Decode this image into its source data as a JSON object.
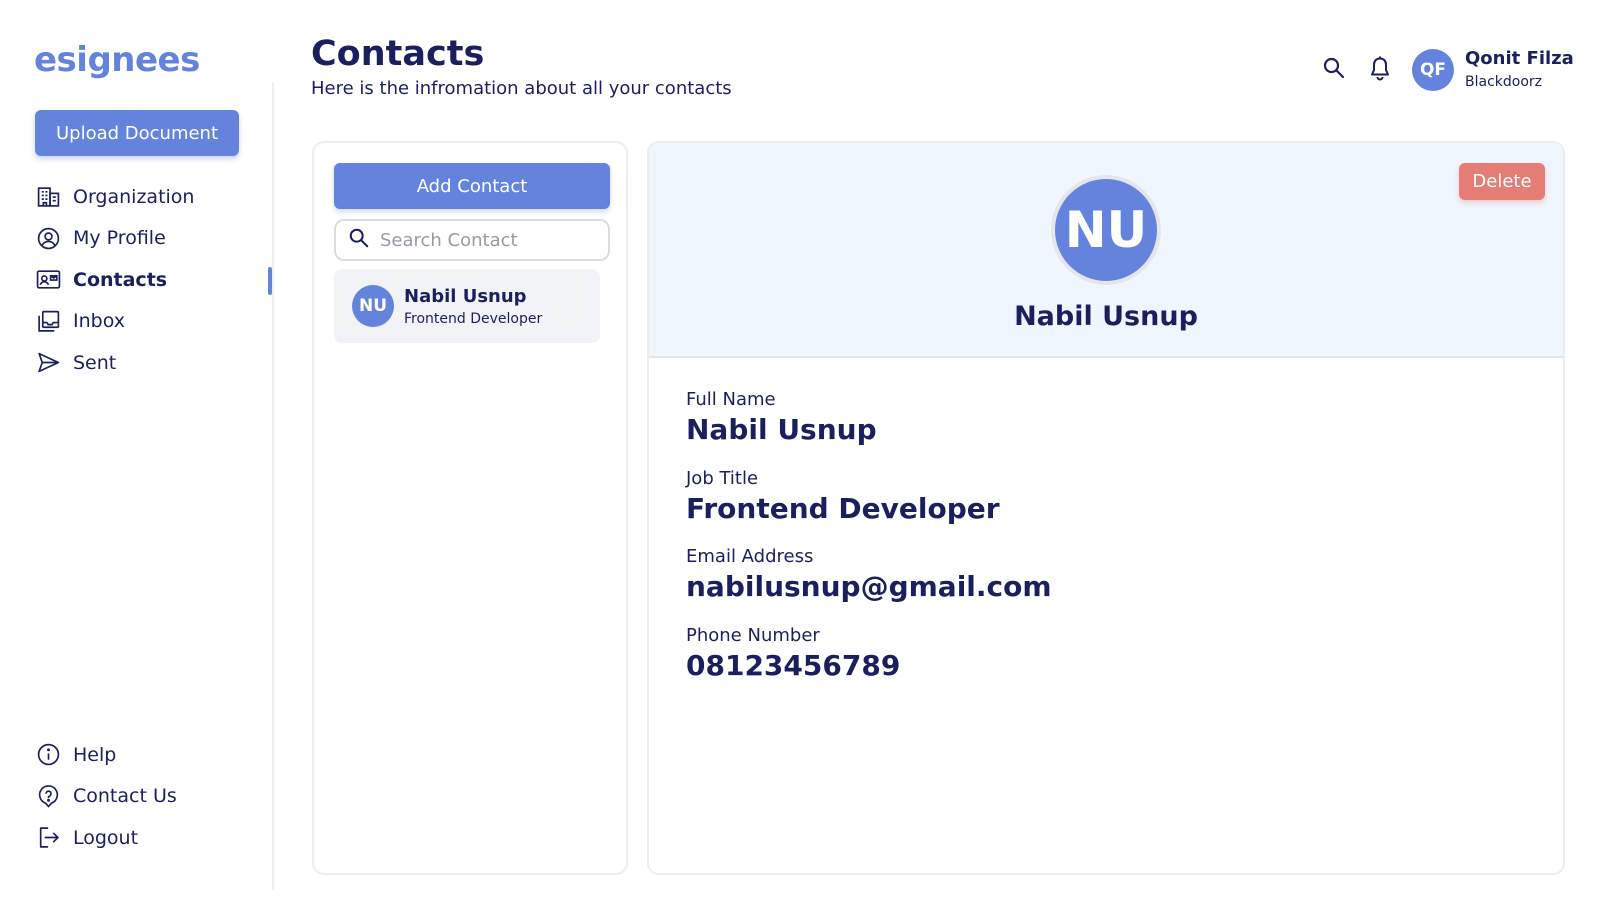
{
  "sidebar": {
    "logo": "esignees",
    "upload_label": "Upload Document",
    "nav": [
      {
        "label": "Organization",
        "icon": "building-icon"
      },
      {
        "label": "My Profile",
        "icon": "user-circle-icon"
      },
      {
        "label": "Contacts",
        "icon": "contact-card-icon",
        "active": true
      },
      {
        "label": "Inbox",
        "icon": "inbox-icon"
      },
      {
        "label": "Sent",
        "icon": "send-icon"
      }
    ],
    "bottom_nav": [
      {
        "label": "Help",
        "icon": "info-icon"
      },
      {
        "label": "Contact Us",
        "icon": "question-icon"
      },
      {
        "label": "Logout",
        "icon": "logout-icon"
      }
    ]
  },
  "header": {
    "title": "Contacts",
    "subtitle": "Here is the infromation about all your contacts",
    "user": {
      "initials": "QF",
      "name": "Qonit Filza",
      "organization": "Blackdoorz"
    }
  },
  "contact_list": {
    "add_label": "Add Contact",
    "search_placeholder": "Search Contact",
    "items": [
      {
        "initials": "NU",
        "name": "Nabil Usnup",
        "role": "Frontend Developer"
      }
    ]
  },
  "detail": {
    "delete_label": "Delete",
    "initials": "NU",
    "name": "Nabil Usnup",
    "fields": [
      {
        "label": "Full Name",
        "value": "Nabil Usnup"
      },
      {
        "label": "Job Title",
        "value": "Frontend Developer"
      },
      {
        "label": "Email Address",
        "value": "nabilusnup@gmail.com"
      },
      {
        "label": "Phone Number",
        "value": "08123456789"
      }
    ]
  },
  "colors": {
    "accent": "#6483dd",
    "text": "#1b1f5e",
    "danger": "#e57c75",
    "hero_bg": "#f0f6fe"
  }
}
